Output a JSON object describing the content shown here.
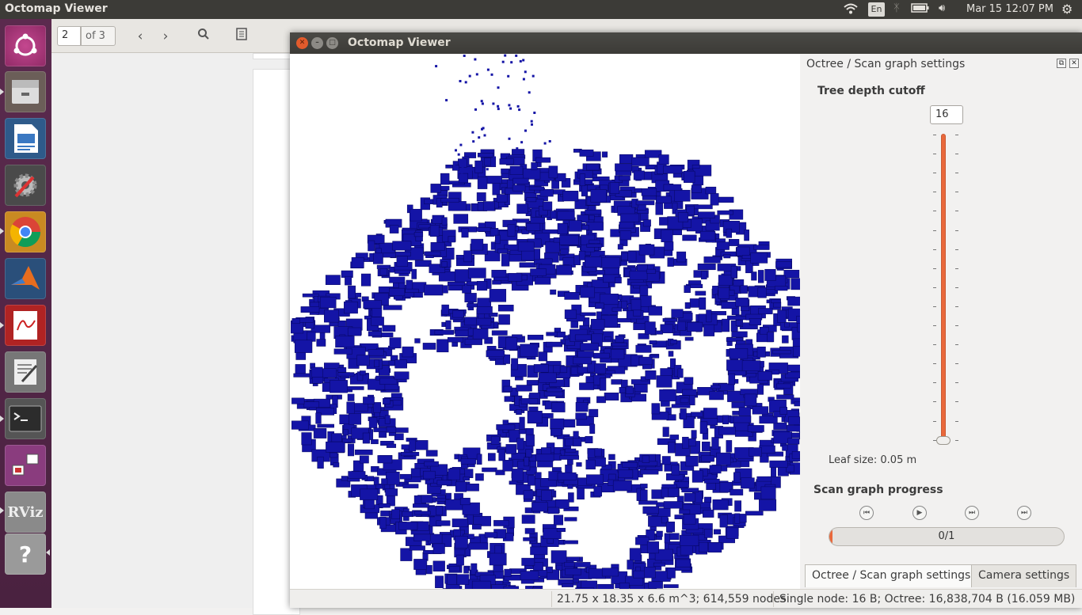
{
  "top_panel": {
    "app_title": "Octomap Viewer",
    "keyboard_layout": "En",
    "clock": "Mar 15 12:07 PM"
  },
  "launcher": {
    "items": [
      "ubuntu-dash",
      "files",
      "libreoffice-writer",
      "system-settings",
      "chrome",
      "matlab",
      "pdf-viewer",
      "text-editor",
      "terminal",
      "desktop-switcher",
      "rviz",
      "help"
    ]
  },
  "doc_viewer": {
    "page_current": "2",
    "page_of": "of 3"
  },
  "octo_window": {
    "title": "Octomap Viewer",
    "panel_title": "Octree / Scan graph settings",
    "tree_depth_label": "Tree depth cutoff",
    "tree_depth_value": "16",
    "leaf_size_label": "Leaf size:  0.05 m",
    "scan_progress_label": "Scan graph progress",
    "progress_text": "0/1",
    "progress_fraction": 0.0,
    "tabs": [
      "Octree / Scan graph settings",
      "Camera settings"
    ],
    "status_dims": "21.75 x 18.35 x 6.6 m^3; 614,559 nodes",
    "status_mem": "Single node: 16 B; Octree: 16,838,704 B (16.059 MB)"
  },
  "colors": {
    "voxel": "#1414a6",
    "voxel_edge": "#060660",
    "accent": "#e9683b",
    "launcher_bg": "#5b2a4e",
    "panel_bg": "#3c3b37"
  }
}
